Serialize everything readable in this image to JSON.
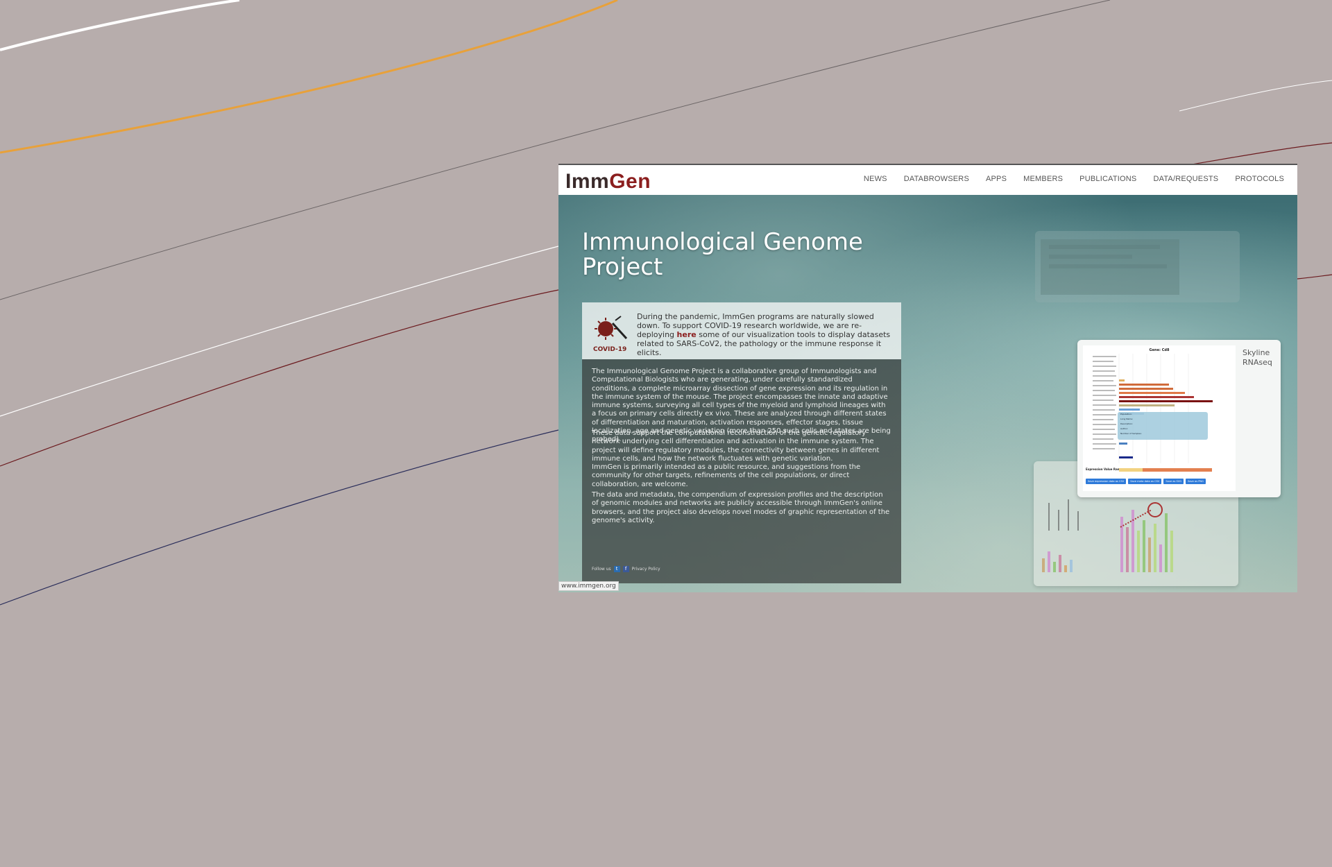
{
  "site": {
    "logo": "ImmGen",
    "logo_part_a": "Imm",
    "logo_part_b": "Gen",
    "nav": [
      "NEWS",
      "DATABROWSERS",
      "APPS",
      "MEMBERS",
      "PUBLICATIONS",
      "DATA/REQUESTS",
      "PROTOCOLS"
    ],
    "title": "Immunological Genome Project",
    "covid": {
      "icon_label": "COVID-19",
      "text_before": "During the pandemic, ImmGen programs are naturally slowed down. To support COVID-19 research worldwide, we are re-deploying ",
      "link": "here",
      "text_after": " some of our visualization tools to display datasets related to SARS-CoV2, the pathology or the immune response it elicits."
    },
    "about": [
      "The Immunological Genome Project is a collaborative group of Immunologists and Computational Biologists who are generating, under carefully standardized conditions, a complete microarray dissection of gene expression and its regulation in the immune system of the mouse. The project encompasses the innate and adaptive immune systems, surveying all cell types of the myeloid and lymphoid lineages with a focus on primary cells directly ex vivo. These are analyzed through different states of differentiation and maturation, activation responses, effector stages, tissue localization, age and genetic variation (more than 250 such cells and states are being probed).",
      "These data support the computational reconstruction of the genetic regulatory network underlying cell differentiation and activation in the immune system. The project will define regulatory modules, the connectivity between genes in different immune cells, and how the network fluctuates with genetic variation.",
      "ImmGen is primarily intended as a public resource, and suggestions from the community for other targets, refinements of the cell populations, or direct collaboration, are welcome.",
      "The data and metadata, the compendium of expression profiles and the description of genomic modules and networks are publicly accessible through ImmGen's online browsers, and the project also develops novel modes of graphic representation of the genome's activity."
    ],
    "follow": "Follow us",
    "privacy": "Privacy Policy",
    "url": "www.immgen.org",
    "skyline": {
      "label": "Skyline RNAseq",
      "gene_title": "Gene: Cd8",
      "range_label": "Expression Value Range",
      "buttons": [
        "Save expression data as CSV",
        "Save meta data as CSV",
        "Save as SVG",
        "Save as PNG"
      ],
      "tooltip": [
        "Population:",
        "Long Name:",
        "Description:",
        "Author:",
        "Number of Samples:"
      ]
    }
  },
  "colors": {
    "background": "#b7adac",
    "logo_red": "#8b1e1e",
    "line_white": "#ffffff",
    "line_orange": "#e8a13a",
    "line_gray": "#6b6566",
    "line_dark_red": "#6b1a1e",
    "line_navy": "#2a2d5a"
  }
}
